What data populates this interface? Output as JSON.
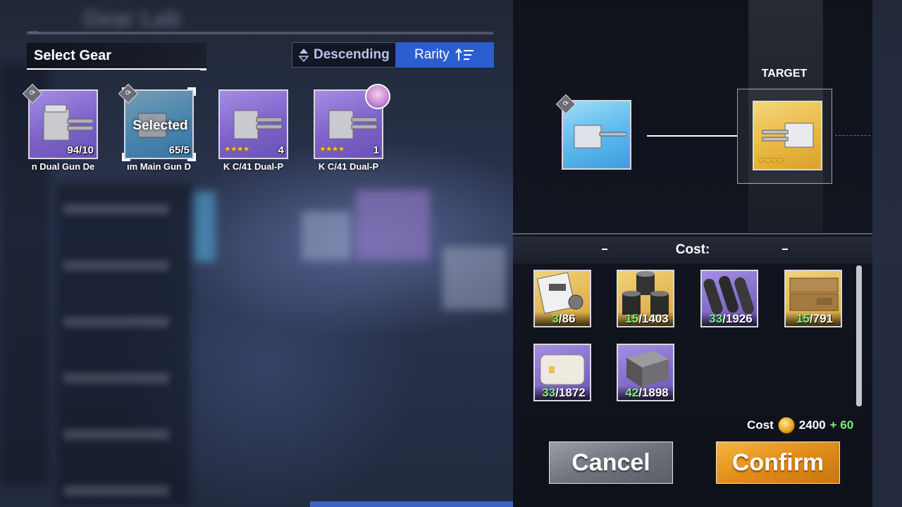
{
  "left_panel": {
    "header_title": "Select Gear",
    "sort_order_label": "Descending",
    "sort_key_label": "Rarity",
    "items": [
      {
        "name": "n Dual Gun De",
        "count": "94/10",
        "stars": "",
        "selected": false,
        "color": "purple"
      },
      {
        "name": "ım Main Gun D",
        "count": "65/5",
        "stars": "",
        "selected": true,
        "selected_label": "Selected",
        "color": "blue"
      },
      {
        "name": "K C/41 Dual-P",
        "count": "4",
        "stars": "★★★★",
        "selected": false,
        "color": "purple"
      },
      {
        "name": "K C/41 Dual-P",
        "count": "1",
        "stars": "★★★★",
        "selected": false,
        "color": "purple"
      }
    ]
  },
  "upgrade": {
    "target_label": "TARGET",
    "target_stars": "★★★★"
  },
  "cost_panel": {
    "title": "Cost:",
    "materials": [
      {
        "icon": "blueprint-icon",
        "have": "3",
        "need": "/86"
      },
      {
        "icon": "steel-drums-icon",
        "have": "15",
        "need": "/1403"
      },
      {
        "icon": "steel-pipes-icon",
        "have": "33",
        "need": "/1926"
      },
      {
        "icon": "ammo-crate-icon",
        "have": "15",
        "need": "/791"
      },
      {
        "icon": "cotton-bale-icon",
        "have": "33",
        "need": "/1872"
      },
      {
        "icon": "metal-ingot-icon",
        "have": "42",
        "need": "/1898"
      }
    ],
    "cost_label": "Cost",
    "cost_amount": "2400",
    "cost_extra": "+ 60"
  },
  "buttons": {
    "cancel_label": "Cancel",
    "confirm_label": "Confirm"
  },
  "colors": {
    "accent_blue": "#2b5fd0",
    "confirm_orange": "#e08d18",
    "have_green": "#7cf07a"
  }
}
